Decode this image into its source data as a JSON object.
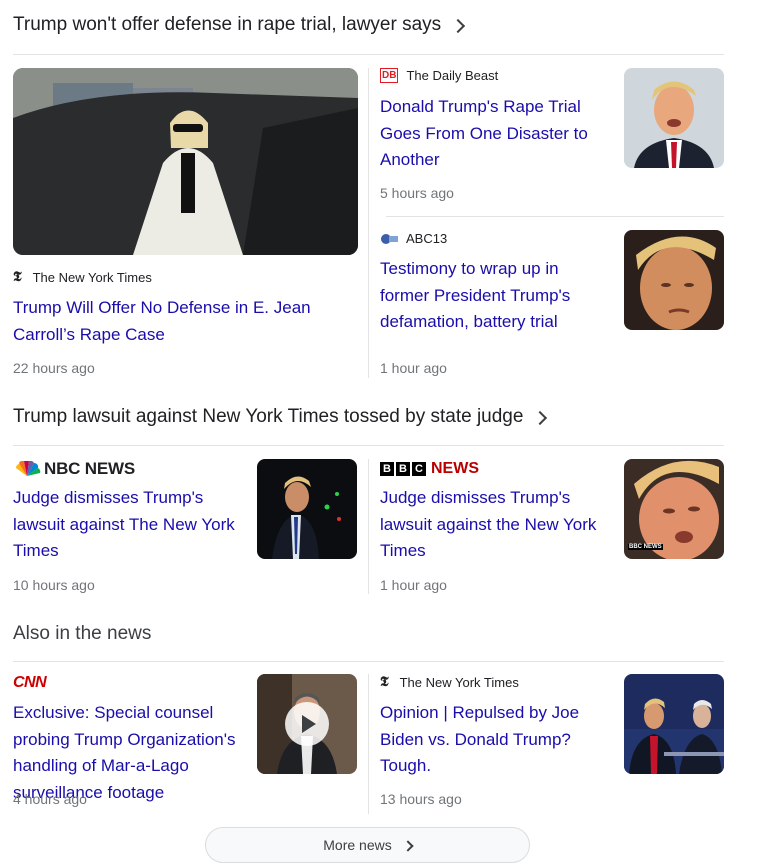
{
  "top_story": {
    "title": "Trump won't offer defense in rape trial, lawyer says",
    "main": {
      "source": "The New York Times",
      "headline": "Trump Will Offer No Defense in E. Jean Carroll’s Rape Case",
      "time": "22 hours ago"
    },
    "side": [
      {
        "source": "The Daily Beast",
        "logo_text": "DB",
        "headline": "Donald Trump's Rape Trial Goes From One Disaster to Another",
        "time": "5 hours ago"
      },
      {
        "source": "ABC13",
        "headline": "Testimony to wrap up in former President Trump's defamation, battery trial",
        "time": "1 hour ago"
      }
    ]
  },
  "second_story": {
    "title": "Trump lawsuit against New York Times tossed by state judge",
    "items": [
      {
        "source": "NBC NEWS",
        "headline": "Judge dismisses Trump's lawsuit against The New York Times",
        "time": "10 hours ago"
      },
      {
        "source_letters": [
          "B",
          "B",
          "C"
        ],
        "source": "NEWS",
        "thumb_badge": "BBC NEWS",
        "headline": "Judge dismisses Trump's lawsuit against the New York Times",
        "time": "1 hour ago"
      }
    ]
  },
  "also": {
    "title": "Also in the news",
    "items": [
      {
        "source": "CNN",
        "headline": "Exclusive: Special counsel probing Trump Organization's handling of Mar-a-Lago surveillance footage",
        "time": "4 hours ago"
      },
      {
        "source": "The New York Times",
        "headline": "Opinion | Repulsed by Joe Biden vs. Donald Trump? Tough.",
        "time": "13 hours ago"
      }
    ]
  },
  "more_news_label": "More news",
  "colors": {
    "link": "#1a0dab",
    "meta": "#70757a",
    "nbc_red": "#e4002b",
    "bbc_red": "#b80000",
    "cnn_red": "#cc0000",
    "db_red": "#e31b23"
  }
}
